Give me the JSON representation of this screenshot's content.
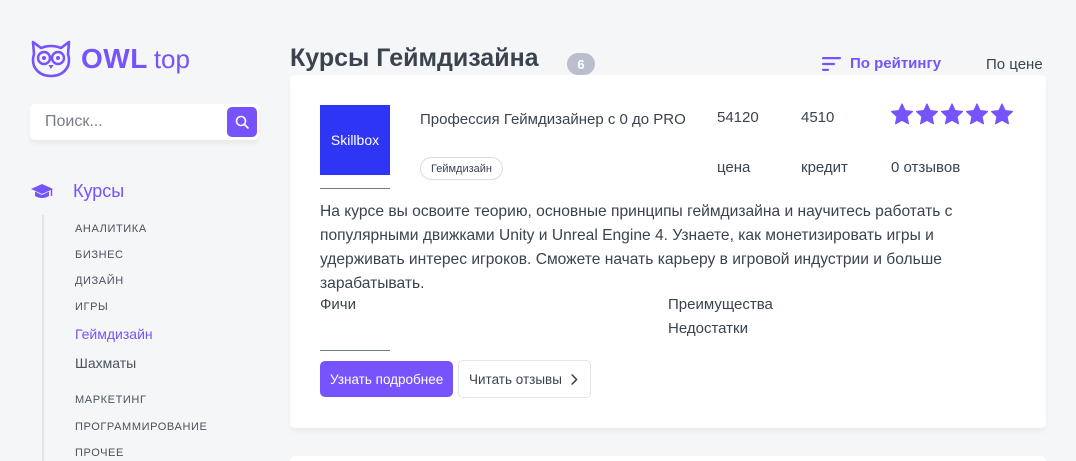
{
  "brand": {
    "name": "OWL",
    "suffix": "top",
    "accent": "#7653fc"
  },
  "search": {
    "placeholder": "Поиск..."
  },
  "sidebar": {
    "section_label": "Курсы",
    "items": [
      {
        "label": "Аналитика"
      },
      {
        "label": "Бизнес"
      },
      {
        "label": "Дизайн"
      },
      {
        "label": "Игры"
      },
      {
        "label": "Геймдизайн",
        "active": true
      },
      {
        "label": "Шахматы"
      },
      {
        "label": "Маркетинг"
      },
      {
        "label": "Программирование"
      },
      {
        "label": "Прочее"
      }
    ]
  },
  "header": {
    "title": "Курсы Геймдизайна",
    "count": "6",
    "sort_rating": "По рейтингу",
    "sort_price": "По цене"
  },
  "course": {
    "logo_text": "Skillbox",
    "logo_color": "#2f35f5",
    "title": "Профессия Геймдизайнер с 0 до PRO",
    "tag": "Геймдизайн",
    "price": "54120",
    "credit": "4510",
    "price_label": "цена",
    "credit_label": "кредит",
    "rating": 5,
    "reviews": "0 отзывов",
    "description": "На курсе вы освоите теорию, основные принципы геймдизайна и научитесь работать с популярными движками Unity и Unreal Engine 4. Узнаете, как монетизировать игры и удерживать интерес игроков. Сможете начать карьеру в игровой индустрии и больше зарабатывать.",
    "features_label": "Фичи",
    "advantages_label": "Преимущества",
    "disadvantages_label": "Недостатки",
    "more_button": "Узнать подробнее",
    "reviews_button": "Читать отзывы"
  }
}
